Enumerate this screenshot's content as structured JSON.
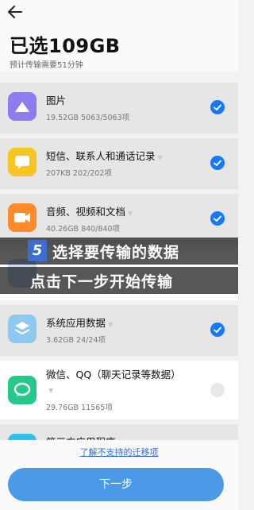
{
  "header": {
    "title": "已选109GB",
    "subtitle": "预计传输需要51分钟"
  },
  "items": [
    {
      "name": "图片",
      "meta": "19.52GB  5063/5063项",
      "checked": true,
      "color": "#8b7cf0",
      "icon": "photo-icon"
    },
    {
      "name": "短信、联系人和通话记录",
      "meta": "207KB  202/202项",
      "checked": true,
      "color": "#f7c623",
      "icon": "message-icon"
    },
    {
      "name": "音频、视频和文档",
      "meta": "40.26GB  840/840项",
      "checked": true,
      "color": "#ff8a2a",
      "icon": "video-icon"
    },
    {
      "name": "系统应用数据",
      "meta": "3.62GB  24/24项",
      "checked": true,
      "color": "#8fc9f0",
      "icon": "layers-icon"
    },
    {
      "name": "微信、QQ（聊天记录等数据）",
      "meta": "29.76GB  11565项",
      "checked": false,
      "color": "#27c98b",
      "icon": "chat-icon"
    },
    {
      "name": "第三方应用程序",
      "meta": "",
      "checked": true,
      "color": "#2ec1ef",
      "icon": "app-icon"
    }
  ],
  "overlay": {
    "step": "5",
    "line1": "选择要传输的数据",
    "line2": "点击下一步开始传输"
  },
  "footer": {
    "link": "了解不支持的迁移项",
    "button": "下一步"
  }
}
